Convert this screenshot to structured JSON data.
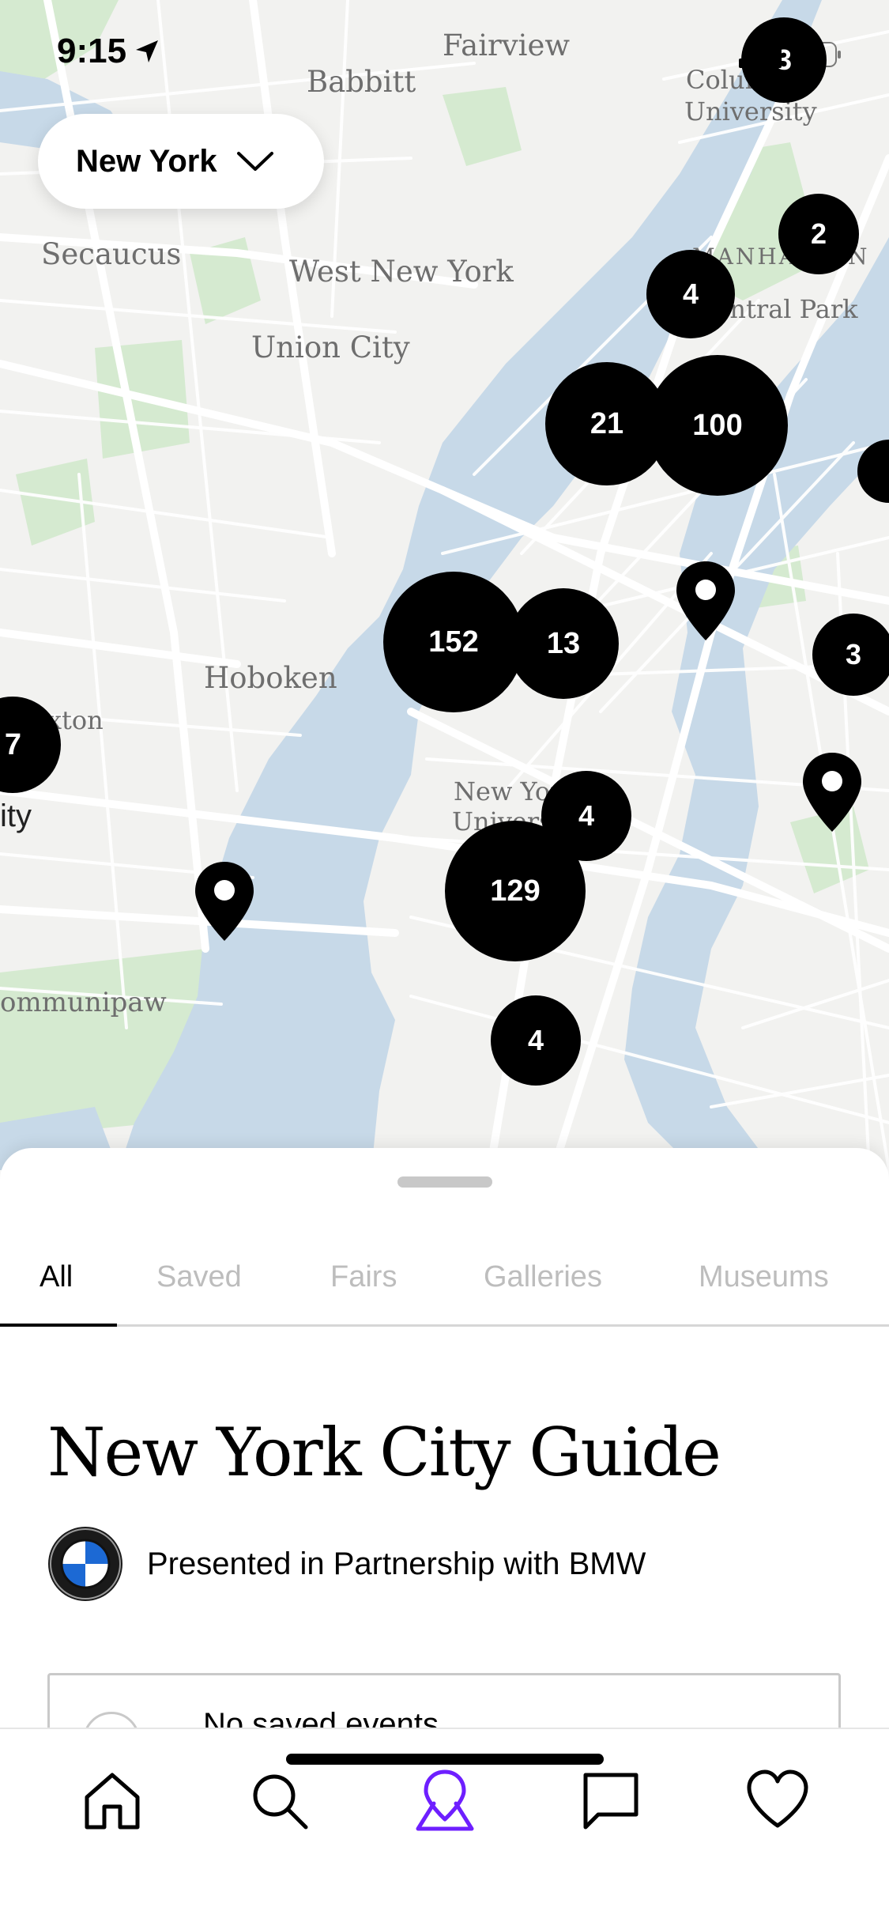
{
  "status_bar": {
    "time": "9:15"
  },
  "city_selector": {
    "label": "New York"
  },
  "map": {
    "places": {
      "fairview": "Fairview",
      "babbitt": "Babbitt",
      "columbia": "Columbia",
      "university": "University",
      "secaucus": "Secaucus",
      "west_new_york": "West New York",
      "manhattan": "MANHATTAN",
      "central_park": "Central Park",
      "union_city": "Union City",
      "hoboken": "Hoboken",
      "paxton": "xton",
      "city_left": "ity",
      "nyu1": "New York",
      "nyu2": "University",
      "communipaw": "ommunipaw"
    },
    "clusters": [
      "3",
      "2",
      "4",
      "21",
      "100",
      "152",
      "13",
      "3",
      "7",
      "4",
      "129",
      "4"
    ]
  },
  "sheet": {
    "tabs": [
      "All",
      "Saved",
      "Fairs",
      "Galleries",
      "Museums"
    ],
    "guide_title": "New York City Guide",
    "partner_text": "Presented in Partnership with BMW",
    "saved_events_text": "No saved events"
  },
  "nav_icons": [
    "home-icon",
    "search-icon",
    "map-pin-icon",
    "chat-icon",
    "heart-icon"
  ],
  "colors": {
    "water": "#c7d9e8",
    "park": "#d5ead0",
    "active_nav": "#6e1fff",
    "cluster": "#000000"
  }
}
